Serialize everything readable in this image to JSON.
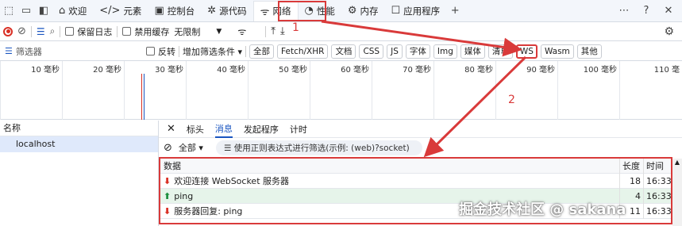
{
  "tabbar": {
    "tabs": [
      {
        "icon": "home-icon",
        "label": "欢迎"
      },
      {
        "icon": "code-icon",
        "label": "元素"
      },
      {
        "icon": "console-icon",
        "label": "控制台"
      },
      {
        "icon": "bug-icon",
        "label": "源代码"
      },
      {
        "icon": "wifi-icon",
        "label": "网络"
      },
      {
        "icon": "gauge-icon",
        "label": "性能"
      },
      {
        "icon": "memory-icon",
        "label": "内存"
      },
      {
        "icon": "app-icon",
        "label": "应用程序"
      }
    ],
    "add_label": "+"
  },
  "toolbar": {
    "preserve_log": "保留日志",
    "disable_cache": "禁用缓存",
    "throttle": "无限制"
  },
  "filterbar": {
    "placeholder": "筛选器",
    "invert": "反转",
    "more_filters": "增加筛选条件",
    "types": [
      "全部",
      "Fetch/XHR",
      "文档",
      "CSS",
      "JS",
      "字体",
      "Img",
      "媒体",
      "清单",
      "WS",
      "Wasm",
      "其他"
    ]
  },
  "timeline": {
    "ticks": [
      "10 毫秒",
      "20 毫秒",
      "30 毫秒",
      "40 毫秒",
      "50 毫秒",
      "60 毫秒",
      "70 毫秒",
      "80 毫秒",
      "90 毫秒",
      "100 毫秒",
      "110 毫"
    ]
  },
  "requests": {
    "header": "名称",
    "items": [
      "localhost"
    ]
  },
  "detail": {
    "tabs": [
      "标头",
      "消息",
      "发起程序",
      "计时"
    ],
    "filter_all": "全部",
    "search_placeholder": "使用正则表达式进行筛选(示例: (web)?socket)",
    "columns": [
      "数据",
      "长度",
      "时间"
    ],
    "messages": [
      {
        "dir": "received",
        "data": "欢迎连接 WebSocket 服务器",
        "length": "18",
        "time": "16:33:..."
      },
      {
        "dir": "sent",
        "data": "ping",
        "length": "4",
        "time": "16:33:..."
      },
      {
        "dir": "received",
        "data": "服务器回复: ping",
        "length": "11",
        "time": "16:33:..."
      }
    ]
  },
  "annotations": {
    "n1": "1",
    "n2": "2"
  },
  "watermark": "掘金技术社区 @ sakana"
}
